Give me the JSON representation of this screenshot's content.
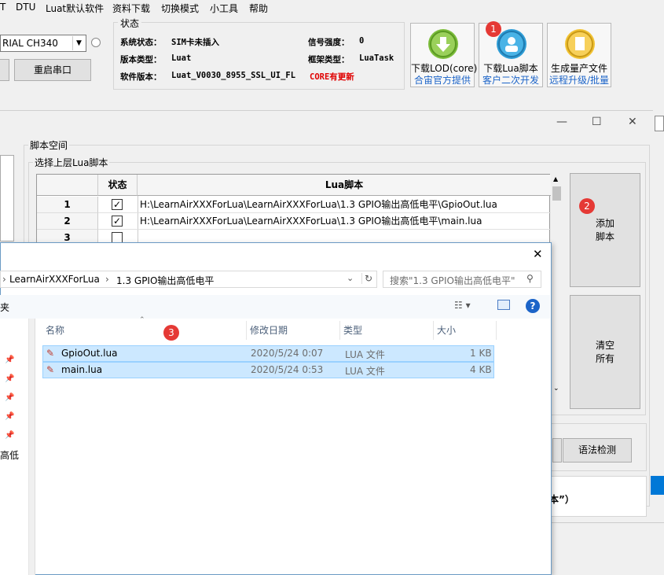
{
  "menu": [
    "T",
    "DTU",
    "Luat默认软件",
    "资料下载",
    "切换模式",
    "小工具",
    "帮助"
  ],
  "port": {
    "combo_value": "RIAL CH340",
    "restart_label": "重启串口"
  },
  "status": {
    "legend": "状态",
    "sys_label": "系统状态：",
    "sys_value": "SIM卡未插入",
    "signal_label": "信号强度：",
    "signal_value": "0",
    "ver_type_label": "版本类型：",
    "ver_type_value": "Luat",
    "frame_label": "框架类型：",
    "frame_value": "LuaTask",
    "soft_label": "软件版本：",
    "soft_value": "Luat_V0030_8955_SSL_UI_FL",
    "soft_note": "CORE有更新"
  },
  "big_buttons": [
    {
      "line1": "下载LOD(core)",
      "line2": "合宙官方提供",
      "color": "#7dbd3c"
    },
    {
      "line1": "下载Lua脚本",
      "line2": "客户二次开发",
      "color": "#2f9dd6"
    },
    {
      "line1": "生成量产文件",
      "line2": "远程升级/批量",
      "color": "#f2c335"
    }
  ],
  "badges": [
    "1",
    "2",
    "3"
  ],
  "window_controls": {
    "minimize": "—",
    "maximize": "☐",
    "close": "✕"
  },
  "script_space": {
    "legend": "脚本空间",
    "inner_legend": "选择上层Lua脚本",
    "headers": {
      "status": "状态",
      "script": "Lua脚本"
    },
    "rows": [
      {
        "num": "1",
        "checked": "✓",
        "path": "H:\\LearnAirXXXForLua\\LearnAirXXXForLua\\1.3 GPIO输出高低电平\\GpioOut.lua"
      },
      {
        "num": "2",
        "checked": "✓",
        "path": "H:\\LearnAirXXXForLua\\LearnAirXXXForLua\\1.3 GPIO输出高低电平\\main.lua"
      },
      {
        "num": "3",
        "checked": "",
        "path": ""
      }
    ],
    "add_line1": "添加",
    "add_line2": "脚本",
    "clear_line1": "清空",
    "clear_line2": "所有",
    "syntax_label": "语法检测",
    "lower_text": "本”）"
  },
  "dialog": {
    "close": "✕",
    "breadcrumb": [
      "LearnAirXXXForLua",
      "1.3 GPIO输出高低电平"
    ],
    "search_placeholder": "搜索\"1.3 GPIO输出高低电平\"",
    "folder_label": "夹",
    "nav_partial": "高低",
    "columns": {
      "name": "名称",
      "date": "修改日期",
      "type": "类型",
      "size": "大小"
    },
    "files": [
      {
        "name": "GpioOut.lua",
        "date": "2020/5/24 0:07",
        "type": "LUA 文件",
        "size": "1 KB"
      },
      {
        "name": "main.lua",
        "date": "2020/5/24 0:53",
        "type": "LUA 文件",
        "size": "4 KB"
      }
    ]
  }
}
